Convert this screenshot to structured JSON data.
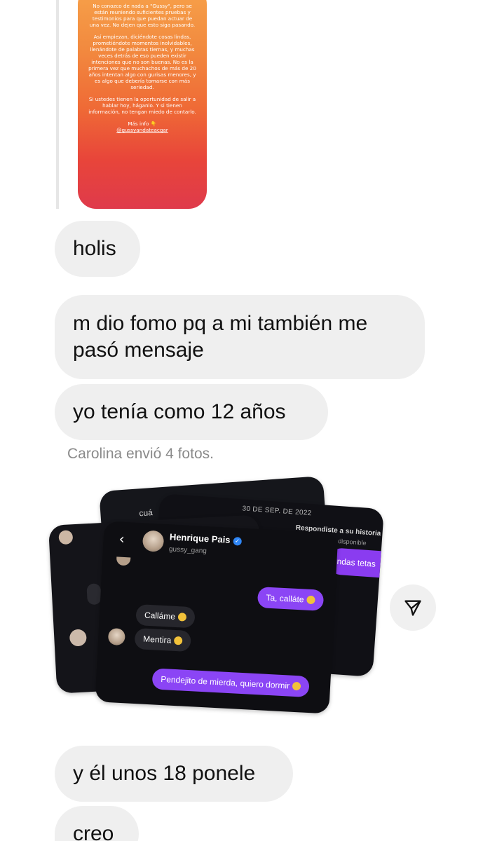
{
  "story": {
    "para1": "No conozco de nada a \"Gussy\", pero se están reuniendo suficientes pruebas y testimonios para que puedan actuar de una vez. No dejen que esto siga pasando.",
    "para2": "Así empiezan, diciéndote cosas lindas, prometiéndote momentos inolvidables, llenándote de palabras tiernas, y muchas veces detrás de eso pueden existir intenciones que no son buenas. No es la primera vez que muchachos de más de 20 años intentan algo con gurisas menores, y es algo que debería tomarse con más seriedad.",
    "para3": "Si ustedes tienen la oportunidad de salir a hablar hoy, háganlo. Y si tienen información, no tengan miedo de contarlo.",
    "more": "Más info 👇",
    "handle": "@gussyandateacgar"
  },
  "messages": {
    "m1": "holis",
    "m2": "m dio fomo pq a mi también me pasó mensaje",
    "m3": "yo tenía como 12 años",
    "m4": "y él unos 18 ponele",
    "m5": "creo"
  },
  "sent_note": "Carolina envió 4 fotos.",
  "photos": {
    "back1_text": "cuá",
    "back2_date": "30 DE SEP. DE 2022",
    "back2_reply": "Respondiste a su historia",
    "back2_unavail": "Historia no disponible",
    "back2_msg": "ndas tetas",
    "front": {
      "name": "Henrique Pais",
      "username": "gussy_gang",
      "msg_sent_1": "Ta, calláte",
      "msg_recv_1": "Calláme",
      "msg_recv_2": "Mentira",
      "msg_sent_2": "Pendejito de mierda, quiero dormir",
      "verified_icon": "verified-badge-icon",
      "accent": "#8b45f5"
    }
  },
  "share_icon": "send-icon"
}
